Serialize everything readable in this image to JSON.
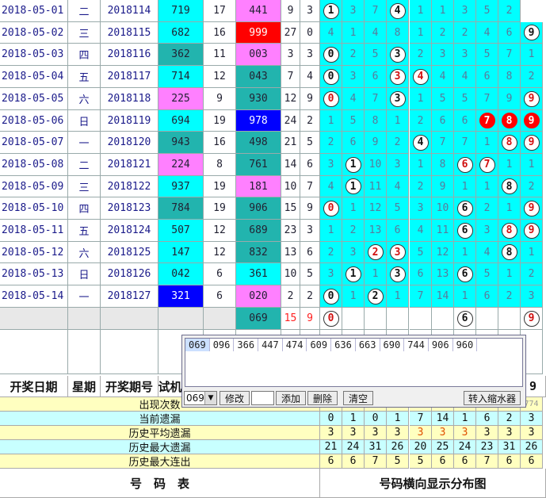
{
  "rows": [
    {
      "date": "2018-05-01",
      "wk": "二",
      "per": "2018114",
      "tr": "719",
      "trc": "cyan",
      "n1": "17",
      "win": "441",
      "winc": "pink",
      "a": "9",
      "b": "3",
      "dist": [
        [
          "1",
          "c"
        ],
        "3",
        "7",
        [
          "4",
          "c"
        ],
        "1",
        "1",
        "3",
        "5",
        "2"
      ]
    },
    {
      "date": "2018-05-02",
      "wk": "三",
      "per": "2018115",
      "tr": "682",
      "trc": "cyan",
      "n1": "16",
      "win": "999",
      "winc": "red",
      "a": "27",
      "b": "0",
      "dist": [
        "4",
        "1",
        "4",
        "8",
        "1",
        "2",
        "2",
        "4",
        "6",
        [
          "9",
          "c"
        ]
      ]
    },
    {
      "date": "2018-05-03",
      "wk": "四",
      "per": "2018116",
      "tr": "362",
      "trc": "teal",
      "n1": "11",
      "win": "003",
      "winc": "pink",
      "a": "3",
      "b": "3",
      "dist": [
        [
          "0",
          "c"
        ],
        "2",
        "5",
        [
          "3",
          "c"
        ],
        "2",
        "3",
        "3",
        "5",
        "7",
        "1"
      ]
    },
    {
      "date": "2018-05-04",
      "wk": "五",
      "per": "2018117",
      "tr": "714",
      "trc": "cyan",
      "n1": "12",
      "win": "043",
      "winc": "teal",
      "a": "7",
      "b": "4",
      "dist": [
        [
          "0",
          "c"
        ],
        "3",
        "6",
        [
          "3",
          "t"
        ],
        [
          "4",
          "t"
        ],
        "4",
        "4",
        "6",
        "8",
        "2"
      ]
    },
    {
      "date": "2018-05-05",
      "wk": "六",
      "per": "2018118",
      "tr": "225",
      "trc": "pink",
      "n1": "9",
      "win": "930",
      "winc": "teal",
      "a": "12",
      "b": "9",
      "dist": [
        [
          "0",
          "t"
        ],
        "4",
        "7",
        [
          "3",
          "c"
        ],
        "1",
        "5",
        "5",
        "7",
        "9",
        [
          "9",
          "t"
        ]
      ]
    },
    {
      "date": "2018-05-06",
      "wk": "日",
      "per": "2018119",
      "tr": "694",
      "trc": "cyan",
      "n1": "19",
      "win": "978",
      "winc": "blue",
      "a": "24",
      "b": "2",
      "dist": [
        "1",
        "5",
        "8",
        "1",
        "2",
        "6",
        "6",
        [
          "7",
          "r"
        ],
        [
          "8",
          "r"
        ],
        [
          "9",
          "r"
        ]
      ]
    },
    {
      "date": "2018-05-07",
      "wk": "一",
      "per": "2018120",
      "tr": "943",
      "trc": "teal",
      "n1": "16",
      "win": "498",
      "winc": "teal",
      "a": "21",
      "b": "5",
      "dist": [
        "2",
        "6",
        "9",
        "2",
        [
          "4",
          "c"
        ],
        "7",
        "7",
        "1",
        [
          "8",
          "t"
        ],
        [
          "9",
          "t"
        ]
      ]
    },
    {
      "date": "2018-05-08",
      "wk": "二",
      "per": "2018121",
      "tr": "224",
      "trc": "pink",
      "n1": "8",
      "win": "761",
      "winc": "teal",
      "a": "14",
      "b": "6",
      "dist": [
        "3",
        [
          "1",
          "c"
        ],
        "10",
        "3",
        "1",
        "8",
        [
          "6",
          "t"
        ],
        [
          "7",
          "t"
        ],
        "1",
        "1"
      ]
    },
    {
      "date": "2018-05-09",
      "wk": "三",
      "per": "2018122",
      "tr": "937",
      "trc": "cyan",
      "n1": "19",
      "win": "181",
      "winc": "pink",
      "a": "10",
      "b": "7",
      "dist": [
        "4",
        [
          "1",
          "c"
        ],
        "11",
        "4",
        "2",
        "9",
        "1",
        "1",
        [
          "8",
          "c"
        ],
        "2"
      ]
    },
    {
      "date": "2018-05-10",
      "wk": "四",
      "per": "2018123",
      "tr": "784",
      "trc": "teal",
      "n1": "19",
      "win": "906",
      "winc": "teal",
      "a": "15",
      "b": "9",
      "dist": [
        [
          "0",
          "t"
        ],
        "1",
        "12",
        "5",
        "3",
        "10",
        [
          "6",
          "c"
        ],
        "2",
        "1",
        [
          "9",
          "t"
        ]
      ]
    },
    {
      "date": "2018-05-11",
      "wk": "五",
      "per": "2018124",
      "tr": "507",
      "trc": "cyan",
      "n1": "12",
      "win": "689",
      "winc": "teal",
      "a": "23",
      "b": "3",
      "dist": [
        "1",
        "2",
        "13",
        "6",
        "4",
        "11",
        [
          "6",
          "c"
        ],
        "3",
        [
          "8",
          "t"
        ],
        [
          "9",
          "t"
        ]
      ]
    },
    {
      "date": "2018-05-12",
      "wk": "六",
      "per": "2018125",
      "tr": "147",
      "trc": "cyan",
      "n1": "12",
      "win": "832",
      "winc": "teal",
      "a": "13",
      "b": "6",
      "dist": [
        "2",
        "3",
        [
          "2",
          "t"
        ],
        [
          "3",
          "t"
        ],
        "5",
        "12",
        "1",
        "4",
        [
          "8",
          "c"
        ],
        "1"
      ]
    },
    {
      "date": "2018-05-13",
      "wk": "日",
      "per": "2018126",
      "tr": "042",
      "trc": "cyan",
      "n1": "6",
      "win": "361",
      "winc": "cyan",
      "a": "10",
      "b": "5",
      "dist": [
        "3",
        [
          "1",
          "c"
        ],
        "1",
        [
          "3",
          "c"
        ],
        "6",
        "13",
        [
          "6",
          "c"
        ],
        "5",
        "1",
        "2"
      ]
    },
    {
      "date": "2018-05-14",
      "wk": "一",
      "per": "2018127",
      "tr": "321",
      "trc": "blue",
      "n1": "6",
      "win": "020",
      "winc": "pink",
      "a": "2",
      "b": "2",
      "dist": [
        [
          "0",
          "c"
        ],
        "1",
        [
          "2",
          "c"
        ],
        "1",
        "7",
        "14",
        "1",
        "6",
        "2",
        "3"
      ]
    }
  ],
  "input_row": {
    "win": "069",
    "a": "15",
    "b": "9",
    "dist": [
      [
        "0",
        "t"
      ],
      "",
      "",
      "",
      "",
      "",
      [
        "6",
        "c"
      ],
      "",
      "",
      [
        "9",
        "t"
      ]
    ]
  },
  "popup": {
    "chips": [
      "069",
      "096",
      "366",
      "447",
      "474",
      "609",
      "636",
      "663",
      "690",
      "744",
      "906",
      "960"
    ],
    "select_value": "069",
    "btn_modify": "修改",
    "btn_add": "添加",
    "btn_delete": "删除",
    "btn_clear": "清空",
    "btn_shrink": "转入缩水器"
  },
  "header": {
    "date": "开奖日期",
    "wk": "星期",
    "per": "开奖期号",
    "tr": "试机",
    "right": "9"
  },
  "stats": [
    {
      "label": "出现次数",
      "vals": [],
      "tail": "774",
      "cls": "yel"
    },
    {
      "label": "当前遗漏",
      "vals": [
        "0",
        "1",
        "0",
        "1",
        "7",
        "14",
        "1",
        "6",
        "2",
        "3"
      ],
      "cls": "cya"
    },
    {
      "label": "历史平均遗漏",
      "vals": [
        "3",
        "3",
        "3",
        "3",
        "3",
        "3",
        "3",
        "3",
        "3",
        "3"
      ],
      "orange": [
        4,
        5,
        6
      ],
      "cls": "yel"
    },
    {
      "label": "历史最大遗漏",
      "vals": [
        "21",
        "24",
        "31",
        "26",
        "20",
        "25",
        "24",
        "23",
        "31",
        "26"
      ],
      "cls": "cya"
    },
    {
      "label": "历史最大连出",
      "vals": [
        "6",
        "6",
        "7",
        "5",
        "5",
        "6",
        "6",
        "7",
        "6",
        "6"
      ],
      "cls": "yel"
    }
  ],
  "footer": {
    "left": "号　码　表",
    "right": "号码横向显示分布图"
  }
}
